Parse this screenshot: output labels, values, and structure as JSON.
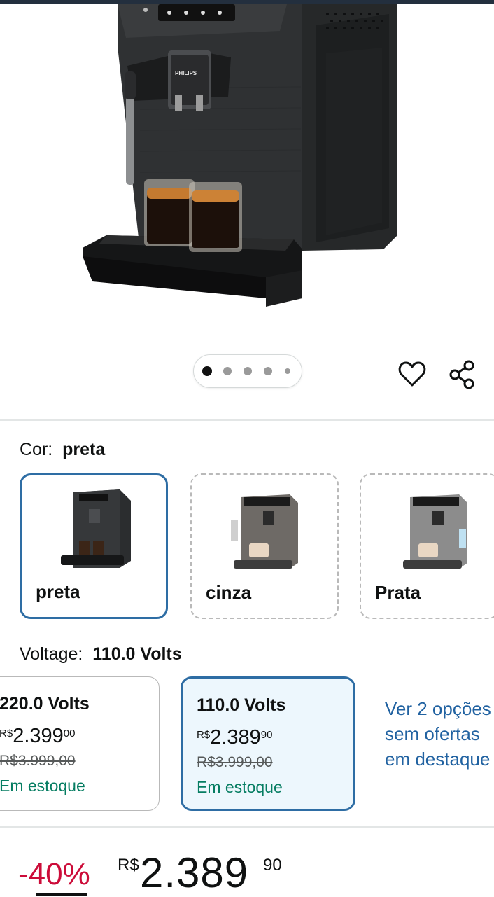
{
  "product": {
    "brand_on_machine": "PHILIPS",
    "image_dots": 5,
    "active_image": 1
  },
  "actions": {
    "wishlist_icon": "heart-outline-icon",
    "share_icon": "share-icon"
  },
  "color_selector": {
    "label": "Cor:",
    "selected": "preta",
    "options": [
      {
        "name": "preta",
        "selected": true,
        "machine_color": "#2b2d2f"
      },
      {
        "name": "cinza",
        "selected": false,
        "machine_color": "#6e6a66"
      },
      {
        "name": "Prata",
        "selected": false,
        "machine_color": "#8c8c8c"
      }
    ]
  },
  "voltage_selector": {
    "label": "Voltage:",
    "selected": "110.0 Volts",
    "options": [
      {
        "title": "220.0 Volts",
        "currency": "R$",
        "price_int": "2.399",
        "price_cents": "00",
        "old_price": "R$3.999,00",
        "stock": "Em estoque",
        "selected": false
      },
      {
        "title": "110.0 Volts",
        "currency": "R$",
        "price_int": "2.389",
        "price_cents": "90",
        "old_price": "R$3.999,00",
        "stock": "Em estoque",
        "selected": true
      }
    ],
    "more_options_link": "Ver 2 opções sem ofertas em destaque"
  },
  "price": {
    "discount": "-40%",
    "currency": "R$",
    "integer": "2.389",
    "cents": "90"
  },
  "colors": {
    "accent_border": "#2e6da4",
    "link": "#2162a1",
    "in_stock": "#067d62",
    "discount": "#cc0c39"
  }
}
